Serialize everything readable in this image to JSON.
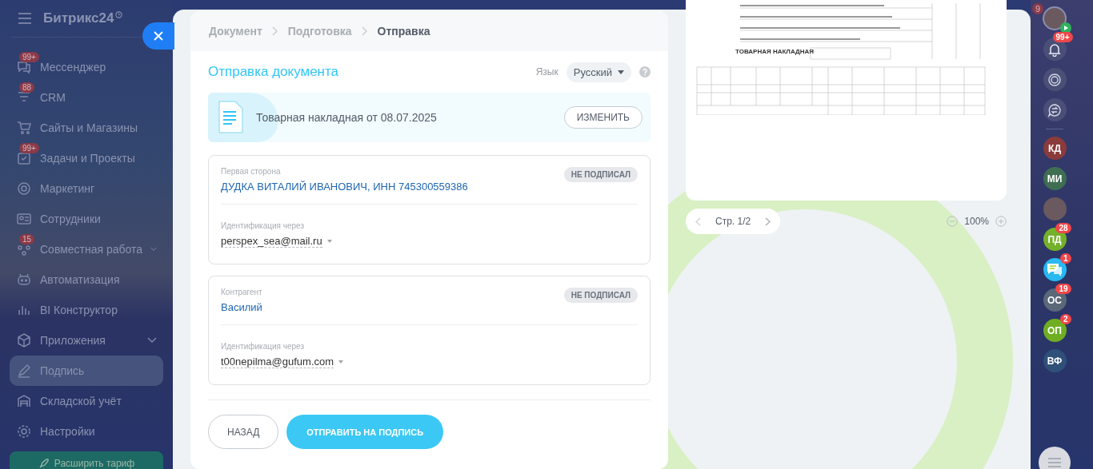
{
  "sidebar": {
    "logo": "Битрикс24",
    "items": [
      {
        "label": "Мессенджер",
        "badge": "99+",
        "expandable": false,
        "selected": false
      },
      {
        "label": "CRM",
        "badge": "88",
        "expandable": false,
        "selected": false
      },
      {
        "label": "Сайты и Магазины",
        "expandable": false,
        "selected": false
      },
      {
        "label": "Задачи и Проекты",
        "badge": "99+",
        "expandable": false,
        "selected": false
      },
      {
        "label": "Маркетинг",
        "expandable": false,
        "selected": false
      },
      {
        "label": "Сотрудники",
        "expandable": false,
        "selected": false
      },
      {
        "label": "Совместная работа",
        "badge": "15",
        "expandable": true,
        "selected": false
      },
      {
        "label": "Автоматизация",
        "expandable": false,
        "selected": false
      },
      {
        "label": "BI Конструктор",
        "expandable": false,
        "selected": false
      },
      {
        "label": "Приложения",
        "expandable": true,
        "selected": false
      },
      {
        "label": "Подпись",
        "expandable": false,
        "selected": true
      },
      {
        "label": "Складской учёт",
        "expandable": false,
        "selected": false
      },
      {
        "label": "Настройки",
        "expandable": false,
        "selected": false
      }
    ],
    "upgrade_button": "Расширить тариф"
  },
  "breadcrumbs": [
    {
      "label": "Документ",
      "selected": false
    },
    {
      "label": "Подготовка",
      "selected": false
    },
    {
      "label": "Отправка",
      "selected": true
    }
  ],
  "title": "Отправка документа",
  "language": {
    "label": "Язык",
    "value": "Русский"
  },
  "document": {
    "name": "Товарная накладная от 08.07.2025",
    "change_button": "ИЗМЕНИТЬ"
  },
  "parties": [
    {
      "role": "Первая сторона",
      "name": "ДУДКА ВИТАЛИЙ ИВАНОВИЧ, ИНН 745300559386",
      "status": "НЕ ПОДПИСАЛ",
      "id_label": "Идентификация через",
      "id_value": "perspex_sea@mail.ru"
    },
    {
      "role": "Контрагент",
      "name": "Василий",
      "status": "НЕ ПОДПИСАЛ",
      "id_label": "Идентификация через",
      "id_value": "t00nepilma@gufum.com"
    }
  ],
  "back_button": "НАЗАД",
  "send_button": "ОТПРАВИТЬ НА ПОДПИСЬ",
  "preview": {
    "doc_title": "ТОВАРНАЯ НАКЛАДНАЯ",
    "page": "Стр. 1/2",
    "zoom": "100%"
  },
  "corner_badge": "9",
  "right_rail": {
    "bell_badge": "99+",
    "contacts": [
      {
        "kind": "initials",
        "initials": "КД",
        "color": "#8a3b3b"
      },
      {
        "kind": "initials",
        "initials": "МИ",
        "color": "#3f6e52"
      },
      {
        "kind": "photo"
      },
      {
        "kind": "initials",
        "initials": "ПД",
        "color": "#73b12a",
        "badge": "28"
      },
      {
        "kind": "chat",
        "badge": "1"
      },
      {
        "kind": "initials",
        "initials": "ОС",
        "color": "#5a6878",
        "badge": "19"
      },
      {
        "kind": "initials",
        "initials": "ОП",
        "color": "#6fae22",
        "badge": "2"
      },
      {
        "kind": "initials",
        "initials": "ВФ",
        "color": "#2e5079"
      }
    ]
  }
}
